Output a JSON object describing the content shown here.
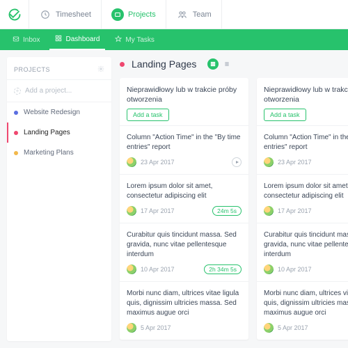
{
  "topnav": {
    "items": [
      {
        "label": "Timesheet"
      },
      {
        "label": "Projects"
      },
      {
        "label": "Team"
      }
    ]
  },
  "subnav": {
    "items": [
      {
        "label": "Inbox"
      },
      {
        "label": "Dashboard"
      },
      {
        "label": "My Tasks"
      }
    ]
  },
  "sidebar": {
    "heading": "PROJECTS",
    "add_placeholder": "Add a project...",
    "projects": [
      {
        "label": "Website Redesign",
        "color": "#5b6ee1"
      },
      {
        "label": "Landing Pages",
        "color": "#ef476f"
      },
      {
        "label": "Marketing Plans",
        "color": "#f2b84b"
      }
    ]
  },
  "page": {
    "title": "Landing Pages"
  },
  "columns": [
    {
      "title": "Nieprawidłowy lub w trakcie próby otworzenia",
      "add_label": "Add a task",
      "tasks": [
        {
          "title": "Column \"Action Time\" in the \"By time entries\" report",
          "date": "23 Apr 2017",
          "play": true
        },
        {
          "title": "Lorem ipsum dolor sit amet, consectetur adipiscing elit",
          "date": "17 Apr 2017",
          "pill": "24m 5s"
        },
        {
          "title": "Curabitur quis tincidunt massa. Sed gravida, nunc vitae pellentesque interdum",
          "date": "10 Apr 2017",
          "pill": "2h 34m 5s"
        },
        {
          "title": "Morbi nunc diam, ultrices vitae ligula quis, dignissim ultricies massa. Sed maximus augue orci",
          "date": "5 Apr 2017"
        }
      ]
    },
    {
      "title": "Nieprawidłowy lub w trakcie próby otworzenia",
      "add_label": "Add a task",
      "tasks": [
        {
          "title": "Column \"Action Time\" in the \"By time entries\" report",
          "date": "23 Apr 2017"
        },
        {
          "title": "Lorem ipsum dolor sit amet, consectetur adipiscing elit",
          "date": "17 Apr 2017"
        },
        {
          "title": "Curabitur quis tincidunt massa. Sed gravida, nunc vitae pellentesque interdum",
          "date": "10 Apr 2017"
        },
        {
          "title": "Morbi nunc diam, ultrices vitae ligula quis, dignissim ultricies massa. Sed maximus augue orci",
          "date": "5 Apr 2017"
        }
      ]
    }
  ]
}
